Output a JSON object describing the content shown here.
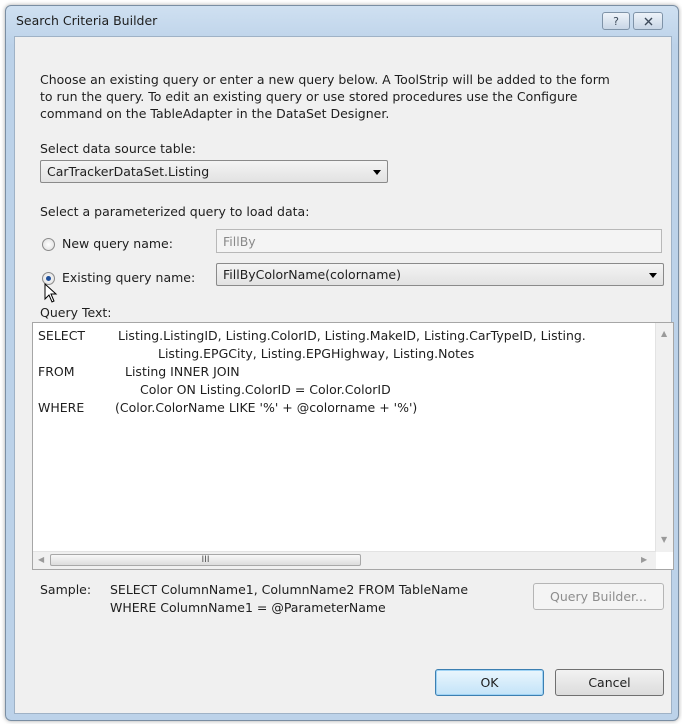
{
  "window": {
    "title": "Search Criteria Builder",
    "help_icon": "?",
    "close_icon": "close-x"
  },
  "intro_text": "Choose an existing query or enter a new query below. A ToolStrip will be added to the form to run the query. To edit an existing query or use stored procedures use the Configure command on the TableAdapter in the DataSet Designer.",
  "intro_lines": [
    "Choose an existing query or enter a new query below. A ToolStrip will be added to the form",
    "to run the query. To edit an existing query or use stored procedures use the Configure",
    "command on the TableAdapter in the DataSet Designer."
  ],
  "data_source": {
    "label": "Select data source table:",
    "value": "CarTrackerDataSet.Listing"
  },
  "query_select_label": "Select a parameterized query to load data:",
  "new_query": {
    "label": "New query name:",
    "value": "FillBy",
    "selected": false
  },
  "existing_query": {
    "label": "Existing query name:",
    "value": "FillByColorName(colorname)",
    "selected": true
  },
  "query_text": {
    "label": "Query Text:",
    "rows": [
      {
        "keyword": "SELECT",
        "text": "Listing.ListingID, Listing.ColorID, Listing.MakeID, Listing.CarTypeID, Listing."
      },
      {
        "keyword": "",
        "text": "Listing.EPGCity, Listing.EPGHighway, Listing.Notes"
      },
      {
        "keyword": "FROM",
        "text": "Listing INNER JOIN"
      },
      {
        "keyword": "",
        "text": "Color ON Listing.ColorID = Color.ColorID"
      },
      {
        "keyword": "WHERE",
        "text": "(Color.ColorName LIKE '%' + @colorname + '%')"
      }
    ]
  },
  "sample": {
    "label": "Sample:",
    "line1": "SELECT ColumnName1, ColumnName2 FROM TableName",
    "line2": "WHERE ColumnName1 = @ParameterName"
  },
  "buttons": {
    "query_builder": "Query Builder...",
    "ok": "OK",
    "cancel": "Cancel"
  },
  "colors": {
    "title_bar": "#bcd2e9",
    "client": "#f0f0f0",
    "default_button": "#c3e3f8",
    "radio_dot": "#1f4f9a"
  }
}
